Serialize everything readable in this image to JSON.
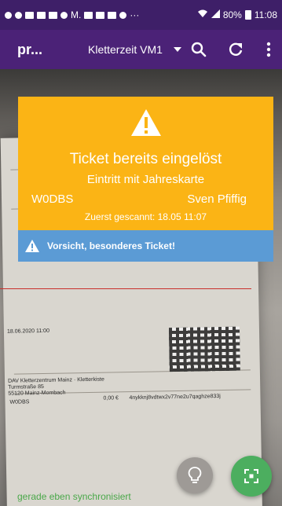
{
  "status_bar": {
    "mail_label": "M.",
    "ellipsis": "···",
    "battery": "80%",
    "time": "11:08"
  },
  "app_bar": {
    "title": "pr...",
    "event": "Kletterzeit VM1"
  },
  "ticket_card": {
    "headline": "Ticket bereits eingelöst",
    "entry_type": "Eintritt mit Jahreskarte",
    "code": "W0DBS",
    "holder": "Sven Pfiffig",
    "scanned_info": "Zuerst gescannt: 18.05 11:07",
    "color": "#fbb415"
  },
  "warning_strip": {
    "text": "Vorsicht, besonderes Ticket!",
    "color": "#5b9bd5"
  },
  "background_document": {
    "date": "18.06.2020 11:00",
    "venue_line1": "DAV Kletterzentrum Mainz · Kletterkiste",
    "venue_line2": "Turmstraße 85",
    "venue_line3": "55120 Mainz-Mombach",
    "code": "W0DBS",
    "price": "0,00 €",
    "hash": "4nykknj8vdtwx2v77ne2u7qaghze833j"
  },
  "sync_status": "gerade eben synchronisiert",
  "actions": {
    "flashlight_icon": "lightbulb-icon",
    "scan_icon": "scan-icon",
    "scan_color": "#4cae5f"
  }
}
